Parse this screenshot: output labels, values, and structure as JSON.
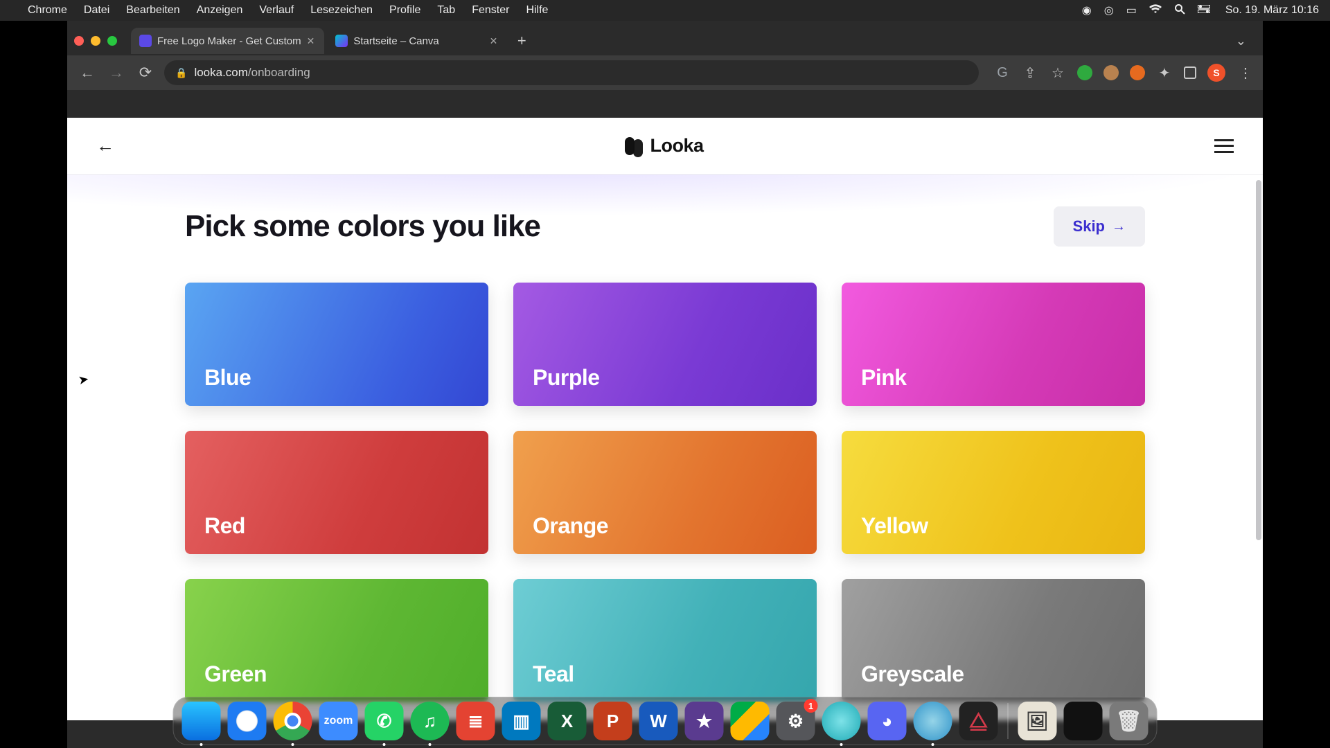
{
  "menubar": {
    "app": "Chrome",
    "items": [
      "Datei",
      "Bearbeiten",
      "Anzeigen",
      "Verlauf",
      "Lesezeichen",
      "Profile",
      "Tab",
      "Fenster",
      "Hilfe"
    ],
    "datetime": "So. 19. März  10:16"
  },
  "browser": {
    "tabs": [
      {
        "title": "Free Logo Maker - Get Custom",
        "active": true
      },
      {
        "title": "Startseite – Canva",
        "active": false
      }
    ],
    "url_display": {
      "domain": "looka.com",
      "path": "/onboarding"
    },
    "avatar_letter": "S"
  },
  "page": {
    "brand": "Looka",
    "heading": "Pick some colors you like",
    "skip_label": "Skip",
    "colors": [
      {
        "key": "blue",
        "label": "Blue"
      },
      {
        "key": "purple",
        "label": "Purple"
      },
      {
        "key": "pink",
        "label": "Pink"
      },
      {
        "key": "red",
        "label": "Red"
      },
      {
        "key": "orange",
        "label": "Orange"
      },
      {
        "key": "yellow",
        "label": "Yellow"
      },
      {
        "key": "green",
        "label": "Green"
      },
      {
        "key": "teal",
        "label": "Teal"
      },
      {
        "key": "greyscale",
        "label": "Greyscale"
      }
    ]
  },
  "dock": {
    "settings_badge": "1",
    "zoom_label": "zoom"
  }
}
